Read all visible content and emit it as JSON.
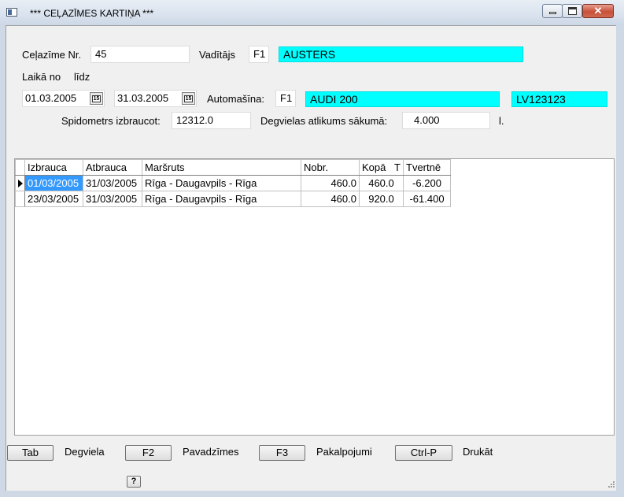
{
  "window": {
    "title": "*** CEĻAZĪMES KARTIŅA ***",
    "minimize_icon": "minimize-icon",
    "maximize_icon": "maximize-icon",
    "close_icon": "close-icon",
    "close_glyph": "✕"
  },
  "header": {
    "trip_no_label": "Ceļazīme Nr.",
    "trip_no_value": "45",
    "driver_label": "Vadītājs",
    "driver_code": "F1",
    "driver_name": "AUSTERS",
    "period_from_label": "Laikā no",
    "period_to_label": "līdz",
    "date_from": "01.03.2005",
    "date_to": "31.03.2005",
    "calendar_glyph": "15",
    "car_label": "Automašīna:",
    "car_code": "F1",
    "car_name": "AUDI 200",
    "car_plate": "LV123123",
    "odometer_label": "Spidometrs izbraucot:",
    "odometer_value": "12312.0",
    "fuel_label": "Degvielas atlikums sākumā:",
    "fuel_value": "4.000",
    "fuel_unit": "l."
  },
  "grid": {
    "columns": [
      "Izbrauca",
      "Atbrauca",
      "Maršruts",
      "Nobr.",
      "Kopā",
      "T",
      "Tvertnē"
    ],
    "rows": [
      {
        "izbrauca": "01/03/2005",
        "atbrauca": "31/03/2005",
        "marsruts": "Rīga - Daugavpils - Rīga",
        "nobr": "460.0",
        "kopa": "460.0",
        "tvertne": "-6.200"
      },
      {
        "izbrauca": "23/03/2005",
        "atbrauca": "31/03/2005",
        "marsruts": "Rīga - Daugavpils - Rīga",
        "nobr": "460.0",
        "kopa": "920.0",
        "tvertne": "-61.400"
      }
    ]
  },
  "footer": {
    "tab_key": "Tab",
    "tab_label": "Degviela",
    "f2_key": "F2",
    "f2_label": "Pavadzīmes",
    "f3_key": "F3",
    "f3_label": "Pakalpojumi",
    "ctrlp_key": "Ctrl-P",
    "ctrlp_label": "Drukāt",
    "help_key": "?"
  },
  "colors": {
    "highlight_field": "#00ffff",
    "selection": "#3399ff"
  }
}
